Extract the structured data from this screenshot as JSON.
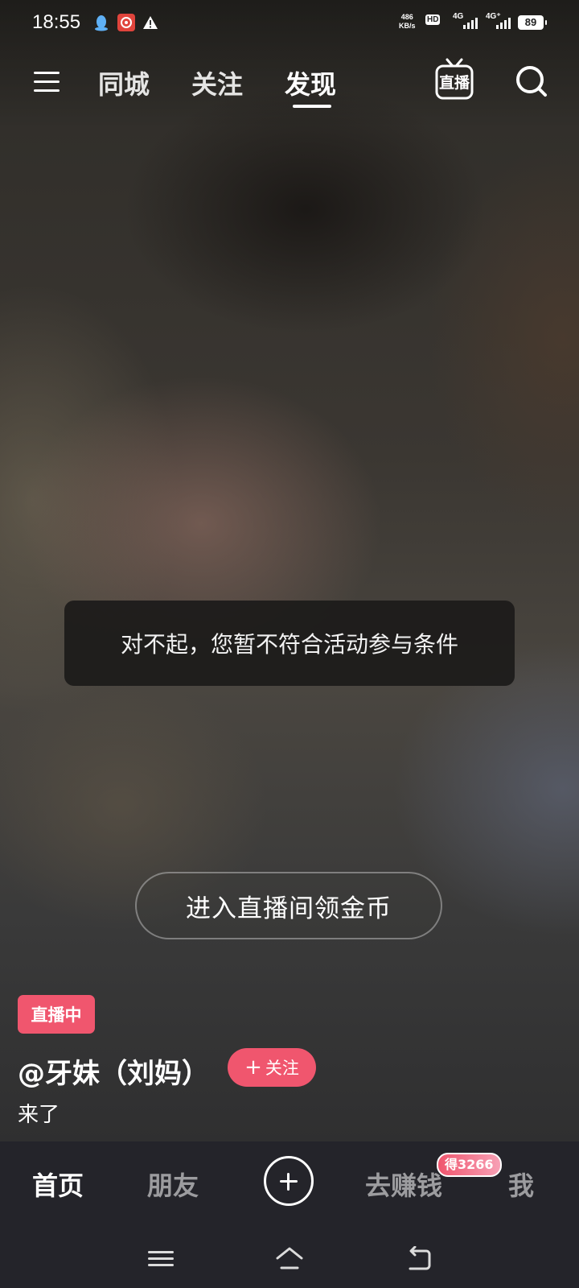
{
  "status_bar": {
    "time": "18:55",
    "net_speed_value": "486",
    "net_speed_unit": "KB/s",
    "hd_label": "HD",
    "sim1_network": "4G",
    "sim2_network": "4G⁺",
    "battery": "89"
  },
  "top_nav": {
    "tabs": [
      {
        "label": "同城"
      },
      {
        "label": "关注"
      },
      {
        "label": "发现"
      }
    ],
    "live_label": "直播"
  },
  "toast": {
    "message": "对不起，您暂不符合活动参与条件"
  },
  "enter_live": {
    "label": "进入直播间领金币"
  },
  "author": {
    "live_badge": "直播中",
    "name": "@牙妹（刘妈）",
    "follow_label": "关注",
    "follow_plus": "+",
    "caption": "来了"
  },
  "bottom_bar": {
    "tabs": [
      {
        "label": "首页"
      },
      {
        "label": "朋友"
      },
      {
        "label": "去赚钱"
      },
      {
        "label": "我"
      }
    ],
    "earn_badge": "得3266"
  },
  "colors": {
    "accent": "#f0566e",
    "bar_background": "#24242a"
  },
  "icons": [
    "menu-icon",
    "live-tv-icon",
    "search-icon",
    "add-icon",
    "qq-icon",
    "netease-music-icon",
    "warning-icon",
    "system-menu-icon",
    "system-home-icon",
    "system-back-icon"
  ]
}
